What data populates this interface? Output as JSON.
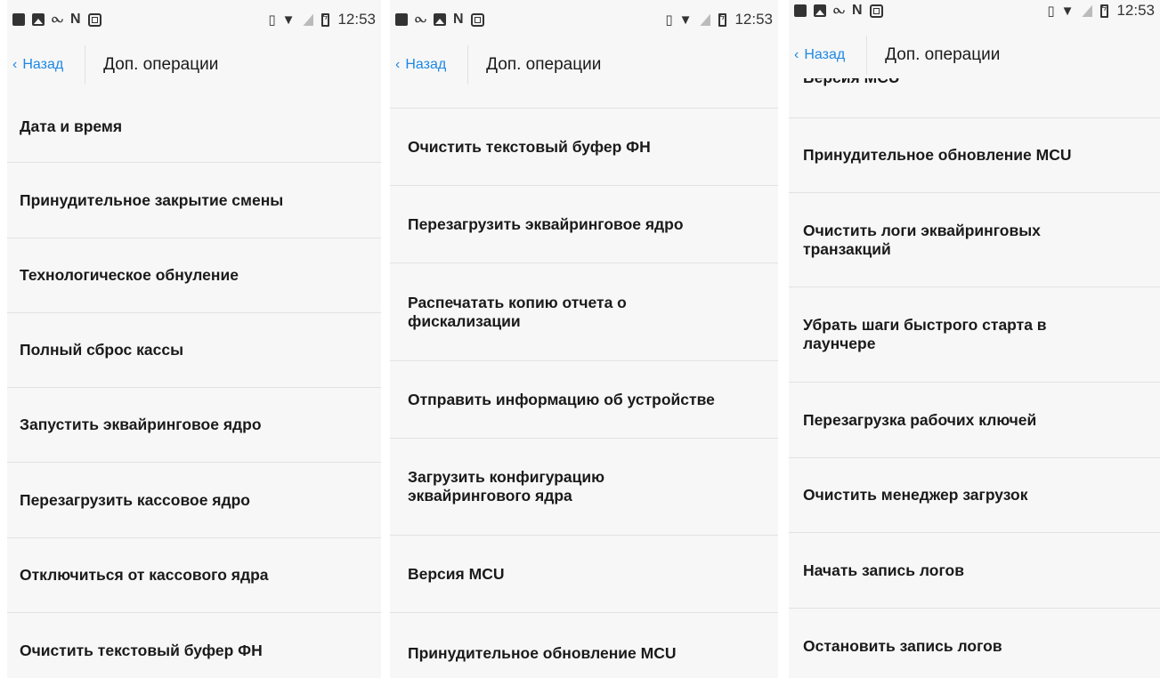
{
  "status_bar": {
    "time": "12:53"
  },
  "header": {
    "back_label": "Назад",
    "title": "Доп. операции"
  },
  "screens": [
    {
      "items": [
        "Дата и время",
        "Принудительное закрытие смены",
        "Технологическое обнуление",
        "Полный сброс кассы",
        "Запустить эквайринговое ядро",
        "Перезагрузить кассовое ядро",
        "Отключиться от кассового ядра",
        "Очистить текстовый буфер ФН"
      ]
    },
    {
      "items": [
        "Очистить текстовый буфер ФН",
        "Перезагрузить эквайринговое ядро",
        "Распечатать копию отчета о фискализации",
        "Отправить информацию об устройстве",
        "Загрузить конфигурацию эквайрингового ядра",
        "Версия MCU",
        "Принудительное обновление MCU"
      ]
    },
    {
      "items": [
        "Версия MCU",
        "Принудительное обновление MCU",
        "Очистить логи эквайринговых транзакций",
        "Убрать шаги быстрого старта в лаунчере",
        "Перезагрузка рабочих ключей",
        "Очистить менеджер загрузок",
        "Начать запись логов",
        "Остановить запись логов"
      ]
    }
  ]
}
